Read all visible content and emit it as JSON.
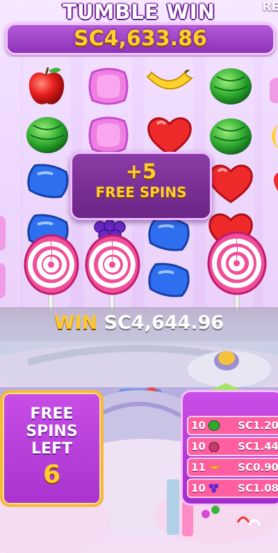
{
  "header": {
    "title": "TUMBLE WIN",
    "amount": "SC4,633.86",
    "corner_label": "RE"
  },
  "banner": {
    "big": "+5",
    "small": "FREE SPINS"
  },
  "win": {
    "label": "WIN",
    "amount": "SC4,644.96"
  },
  "free_spins_left": {
    "label_line1": "FREE",
    "label_line2": "SPINS",
    "label_line3": "LEFT",
    "count": "6"
  },
  "paytable": {
    "rows": [
      {
        "count": "10",
        "symbol": "watermelon-icon",
        "value": "SC1.20"
      },
      {
        "count": "10",
        "symbol": "plum-icon",
        "value": "SC1.44"
      },
      {
        "count": "11",
        "symbol": "banana-icon",
        "value": "SC0.90"
      },
      {
        "count": "10",
        "symbol": "grapes-icon",
        "value": "SC1.08"
      }
    ]
  },
  "colors": {
    "gold": "#ffd02a",
    "purple": "#8e32b9",
    "pink": "#ff5fa0"
  }
}
